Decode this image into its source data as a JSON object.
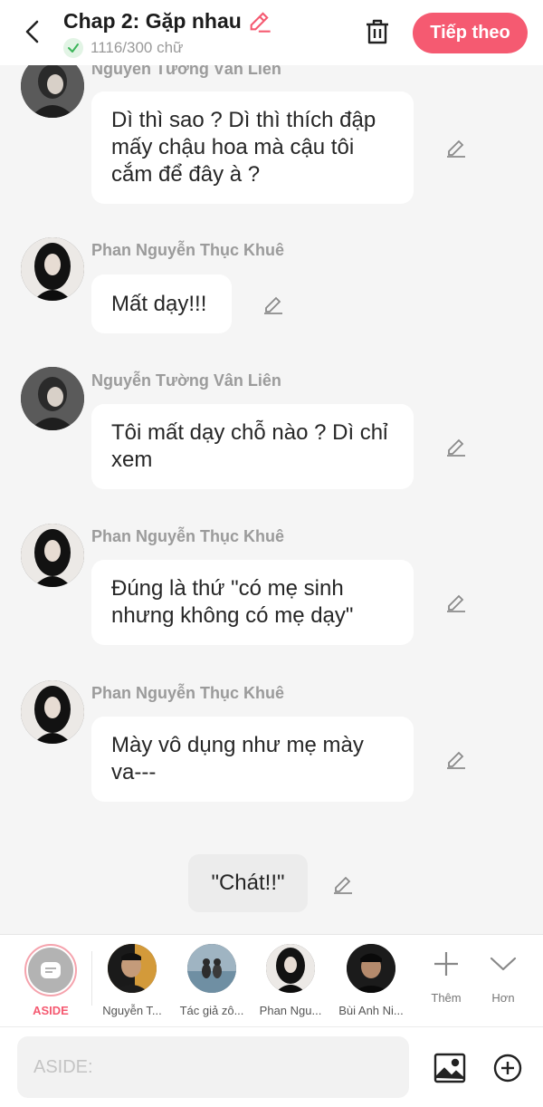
{
  "header": {
    "title": "Chap 2: Gặp nhau",
    "char_count": "1116/300 chữ",
    "next_label": "Tiếp theo"
  },
  "colors": {
    "accent": "#f55a71",
    "bubble": "#ffffff",
    "background": "#f5f5f5"
  },
  "messages": [
    {
      "name": "Nguyễn Tường Vân Liên",
      "lines": [
        "Dì thì sao ? Dì thì thích đập",
        "mấy chậu hoa mà cậu tôi",
        "cắm để đây à ?"
      ]
    },
    {
      "name": "Phan Nguyễn Thục Khuê",
      "lines": [
        "Mất dạy!!!"
      ]
    },
    {
      "name": "Nguyễn Tường Vân Liên",
      "lines": [
        "Tôi mất dạy chỗ nào ? Dì chỉ",
        "xem"
      ]
    },
    {
      "name": "Phan Nguyễn Thục Khuê",
      "lines": [
        "Đúng là thứ \"có mẹ sinh",
        "nhưng không có mẹ dạy\""
      ]
    },
    {
      "name": "Phan Nguyễn Thục Khuê",
      "lines": [
        "Mày vô dụng như mẹ mày",
        "va---"
      ]
    }
  ],
  "aside_message": "\"Chát!!\"",
  "characters": [
    {
      "label": "ASIDE",
      "icon": "aside-icon"
    },
    {
      "label": "Nguyễn T..."
    },
    {
      "label": "Tác giả zô..."
    },
    {
      "label": "Phan Ngu..."
    },
    {
      "label": "Bùi Anh Ni..."
    }
  ],
  "tools": {
    "add_label": "Thêm",
    "more_label": "Hơn"
  },
  "input": {
    "placeholder": "ASIDE:"
  }
}
